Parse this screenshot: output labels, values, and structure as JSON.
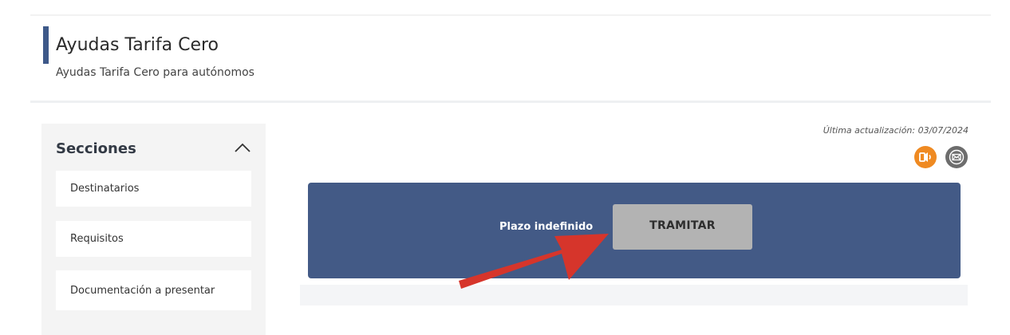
{
  "header": {
    "title": "Ayudas Tarifa Cero",
    "subtitle": "Ayudas Tarifa Cero para autónomos"
  },
  "sidebar": {
    "title": "Secciones",
    "toggle_icon": "chevron-up-icon",
    "items": [
      {
        "label": "Destinatarios"
      },
      {
        "label": "Requisitos"
      },
      {
        "label": "Documentación a presentar"
      }
    ]
  },
  "main": {
    "last_update": "Última actualización: 03/07/2024",
    "tools": [
      {
        "icon": "audio-icon",
        "color": "#ef8a22"
      },
      {
        "icon": "mail-icon",
        "color": "#6d6d6d"
      }
    ],
    "action_panel": {
      "deadline_text": "Plazo indefinido",
      "button_label": "TRAMITAR",
      "panel_color": "#435a86",
      "button_color": "#b3b3b3"
    }
  },
  "annotation": {
    "icon": "red-arrow-icon",
    "color": "#d6352b"
  },
  "colors": {
    "accent": "#3e5989"
  }
}
